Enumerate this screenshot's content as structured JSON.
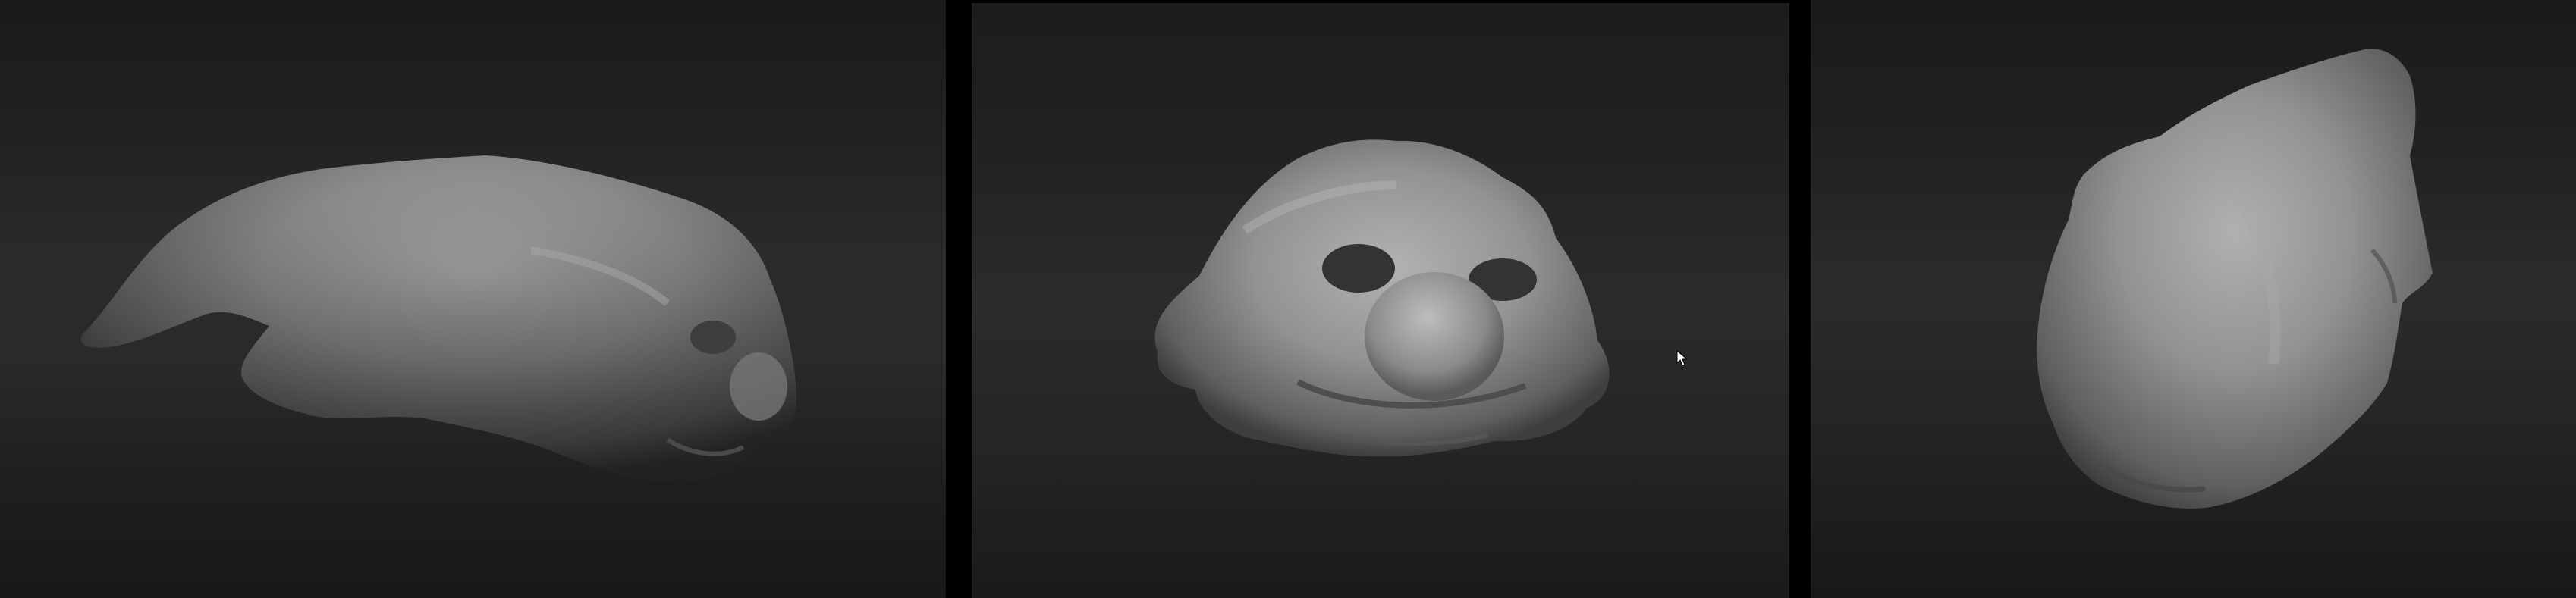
{
  "app": {
    "viewports": [
      {
        "id": "left",
        "view": "side",
        "icon": "sculpt-model-side-icon"
      },
      {
        "id": "center",
        "view": "front",
        "icon": "sculpt-model-front-icon"
      },
      {
        "id": "right",
        "view": "top",
        "icon": "sculpt-model-top-icon"
      }
    ],
    "cursor": {
      "icon": "mouse-pointer-icon"
    }
  },
  "colors": {
    "background": "#2a2a2a",
    "separator": "#000000",
    "model_base": "#8e8e8e",
    "model_highlight": "#b4b4b4",
    "model_shadow": "#4a4a4a"
  }
}
